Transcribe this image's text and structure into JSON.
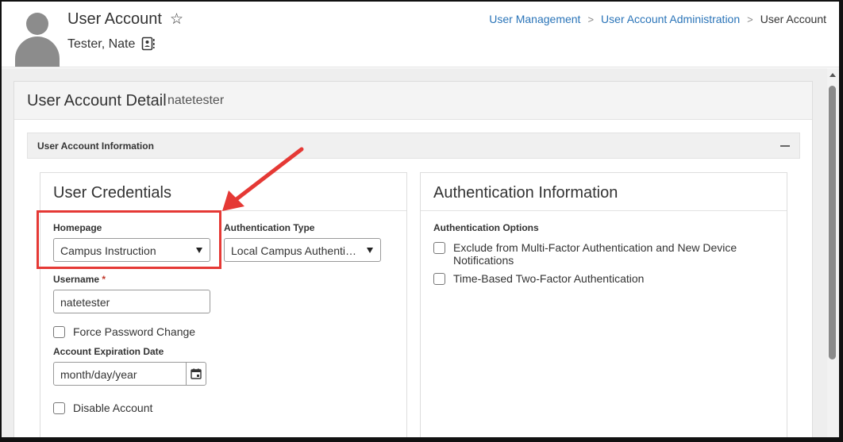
{
  "header": {
    "title": "User Account",
    "person_name": "Tester, Nate",
    "breadcrumb": [
      "User Management",
      "User Account Administration",
      "User Account"
    ]
  },
  "detail": {
    "title": "User Account Detail",
    "username_display": "natetester"
  },
  "section": {
    "title": "User Account Information"
  },
  "credentials": {
    "title": "User Credentials",
    "homepage_label": "Homepage",
    "homepage_value": "Campus Instruction",
    "auth_type_label": "Authentication Type",
    "auth_type_value": "Local Campus Authentication",
    "username_label": "Username",
    "username_required": "*",
    "username_value": "natetester",
    "force_password_label": "Force Password Change",
    "expiration_label": "Account Expiration Date",
    "expiration_placeholder": "month/day/year",
    "disable_label": "Disable Account"
  },
  "authentication": {
    "title": "Authentication Information",
    "options_label": "Authentication Options",
    "options": [
      "Exclude from Multi-Factor Authentication and New Device Notifications",
      "Time-Based Two-Factor Authentication"
    ]
  },
  "colors": {
    "link": "#2a74b8",
    "highlight": "#e53935",
    "required": "#c0392b"
  }
}
